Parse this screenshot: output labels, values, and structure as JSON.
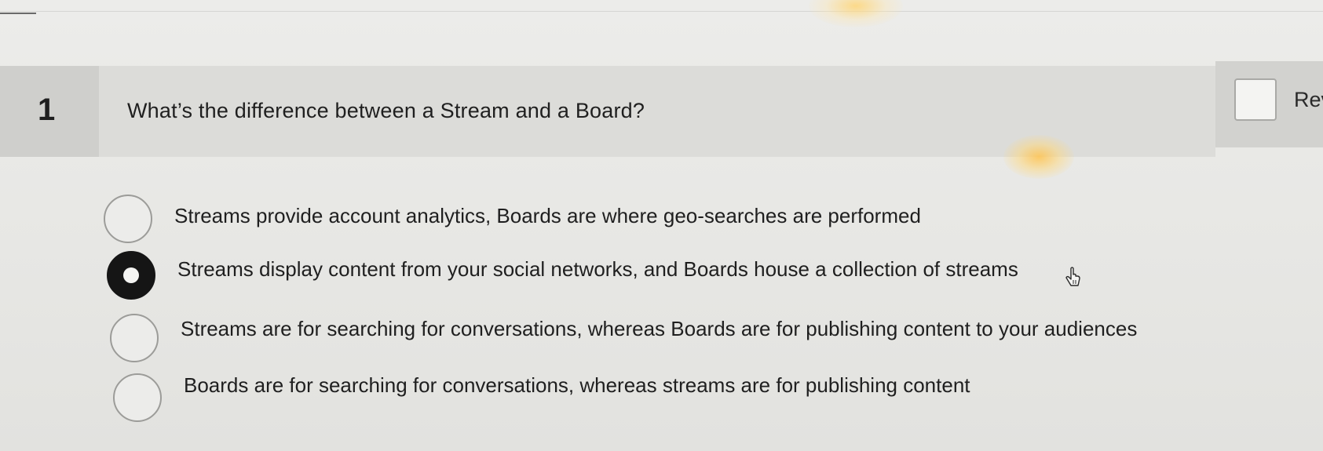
{
  "question": {
    "number": "1",
    "text": "What’s the difference between a Stream and a Board?",
    "review_label": "Rev"
  },
  "options": [
    {
      "label": "Streams provide account analytics, Boards are where geo-searches are performed",
      "selected": false
    },
    {
      "label": "Streams display content from your social networks, and Boards house a collection of streams",
      "selected": true
    },
    {
      "label": "Streams are for searching for conversations, whereas Boards are for publishing content to your audiences",
      "selected": false
    },
    {
      "label": "Boards are for searching for conversations, whereas streams are for publishing content",
      "selected": false
    }
  ],
  "icons": {
    "cursor": "hand-pointer-icon",
    "review_checkbox": "checkbox-icon"
  }
}
